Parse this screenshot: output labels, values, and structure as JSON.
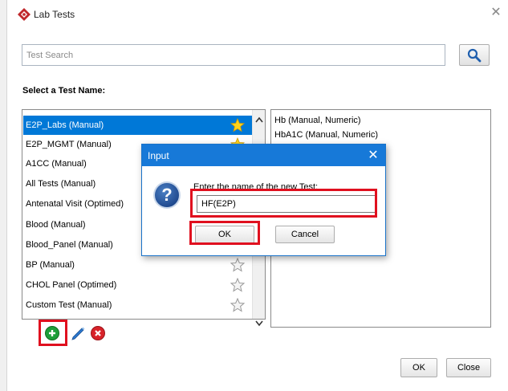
{
  "window": {
    "title": "Lab Tests",
    "close_glyph": "✕",
    "app_icon": "lab-diamond-icon"
  },
  "search": {
    "placeholder": "Test Search",
    "value": "",
    "button_icon": "search-icon"
  },
  "section_label": "Select a Test Name:",
  "test_list": [
    {
      "label": "E2P_Labs (Manual)",
      "selected": true,
      "starred": true
    },
    {
      "label": "E2P_MGMT (Manual)",
      "selected": false,
      "starred": true
    },
    {
      "label": "A1CC (Manual)",
      "selected": false,
      "starred": false
    },
    {
      "label": "All Tests (Manual)",
      "selected": false,
      "starred": false
    },
    {
      "label": "Antenatal Visit (Optimed)",
      "selected": false,
      "starred": false
    },
    {
      "label": "Blood (Manual)",
      "selected": false,
      "starred": false
    },
    {
      "label": "Blood_Panel (Manual)",
      "selected": false,
      "starred": false
    },
    {
      "label": "BP (Manual)",
      "selected": false,
      "starred": false
    },
    {
      "label": "CHOL Panel (Optimed)",
      "selected": false,
      "starred": false
    },
    {
      "label": "Custom Test (Manual)",
      "selected": false,
      "starred": false
    }
  ],
  "right_list": [
    "Hb (Manual, Numeric)",
    "HbA1C (Manual, Numeric)"
  ],
  "toolbar": {
    "add_icon": "plus-circle-icon",
    "edit_icon": "pencil-icon",
    "delete_icon": "x-circle-icon"
  },
  "footer": {
    "ok_label": "OK",
    "close_label": "Close"
  },
  "dialog": {
    "title": "Input",
    "close_glyph": "✕",
    "prompt": "Enter the name of the new Test:",
    "input_value": "HF(E2P)",
    "ok_label": "OK",
    "cancel_label": "Cancel"
  },
  "colors": {
    "selection": "#0078d7",
    "dialog_titlebar": "#1779d8",
    "highlight_box": "#e0101f",
    "add_button": "#1e9e3a",
    "edit_button": "#2b78d0",
    "delete_button": "#d8232a"
  }
}
